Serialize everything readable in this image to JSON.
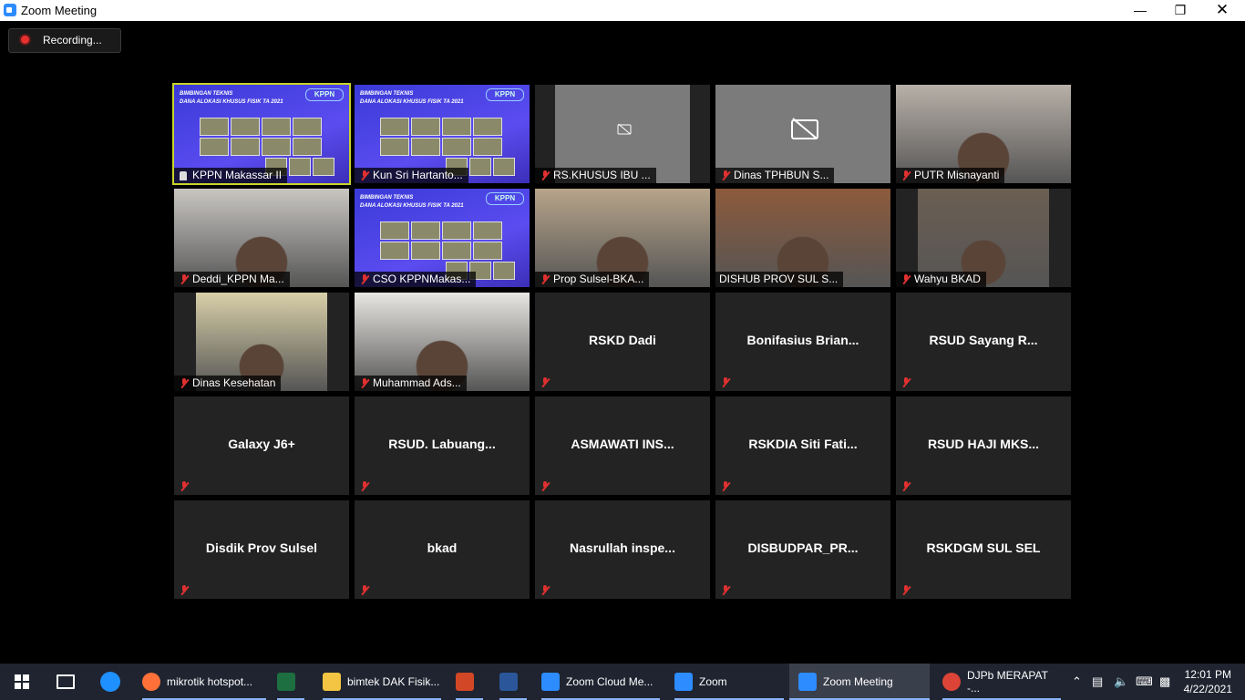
{
  "window": {
    "title": "Zoom Meeting"
  },
  "recording": {
    "label": "Recording..."
  },
  "participants": [
    {
      "name": "KPPN Makassar II",
      "kind": "slide",
      "active": true,
      "pinned": true
    },
    {
      "name": "Kun Sri Hartanto...",
      "kind": "slide"
    },
    {
      "name": "RS.KHUSUS IBU ...",
      "kind": "camoff-small"
    },
    {
      "name": "Dinas TPHBUN S...",
      "kind": "camoff"
    },
    {
      "name": "PUTR Misnayanti",
      "kind": "video",
      "tone": "#b8b0a8"
    },
    {
      "name": "Deddi_KPPN Ma...",
      "kind": "video",
      "tone": "#c9c6c2"
    },
    {
      "name": "CSO KPPNMakas...",
      "kind": "slide"
    },
    {
      "name": "Prop Sulsel-BKA...",
      "kind": "video",
      "tone": "#b7a48a"
    },
    {
      "name": "DISHUB PROV SUL S...",
      "kind": "video",
      "tone": "#8c5a3c",
      "nomic": true
    },
    {
      "name": "Wahyu BKAD",
      "kind": "video-narrow",
      "tone": "#6b5e52"
    },
    {
      "name": "Dinas Kesehatan",
      "kind": "video-narrow",
      "tone": "#d8cfa8"
    },
    {
      "name": "Muhammad Ads...",
      "kind": "video",
      "tone": "#e8e6e2"
    },
    {
      "name": "RSKD Dadi",
      "kind": "name"
    },
    {
      "name": "Bonifasius  Brian...",
      "kind": "name"
    },
    {
      "name": "RSUD  Sayang  R...",
      "kind": "name"
    },
    {
      "name": "Galaxy J6+",
      "kind": "name"
    },
    {
      "name": "RSUD.  Labuang...",
      "kind": "name"
    },
    {
      "name": "ASMAWATI   INS...",
      "kind": "name"
    },
    {
      "name": "RSKDIA  Siti  Fati...",
      "kind": "name"
    },
    {
      "name": "RSUD  HAJI  MKS...",
      "kind": "name"
    },
    {
      "name": "Disdik Prov Sulsel",
      "kind": "name"
    },
    {
      "name": "bkad",
      "kind": "name"
    },
    {
      "name": "Nasrullah  inspe...",
      "kind": "name"
    },
    {
      "name": "DISBUDPAR_PR...",
      "kind": "name"
    },
    {
      "name": "RSKDGM SUL SEL",
      "kind": "name"
    }
  ],
  "slide": {
    "line1": "BIMBINGAN TEKNIS",
    "line2": "DANA ALOKASI KHUSUS FISIK TA 2021",
    "logo": "KPPN"
  },
  "taskbar": {
    "items": [
      {
        "label": "mikrotik hotspot...",
        "icon": "firefox-icon",
        "color": "#ff7139"
      },
      {
        "label": "",
        "icon": "excel-icon",
        "color": "#1d6f42"
      },
      {
        "label": "bimtek DAK Fisik...",
        "icon": "folder-icon",
        "color": "#f4c542"
      },
      {
        "label": "",
        "icon": "powerpoint-icon",
        "color": "#d24726"
      },
      {
        "label": "",
        "icon": "word-icon",
        "color": "#2b579a"
      },
      {
        "label": "Zoom Cloud Me...",
        "icon": "zoom-icon",
        "color": "#2d8cff"
      },
      {
        "label": "Zoom",
        "icon": "zoom-icon",
        "color": "#2d8cff"
      },
      {
        "label": "Zoom Meeting",
        "icon": "zoom-icon",
        "color": "#2d8cff"
      },
      {
        "label": "DJPb MERAPAT -...",
        "icon": "chrome-icon",
        "color": "#db4437"
      }
    ],
    "time": "12:01 PM",
    "date": "4/22/2021"
  }
}
